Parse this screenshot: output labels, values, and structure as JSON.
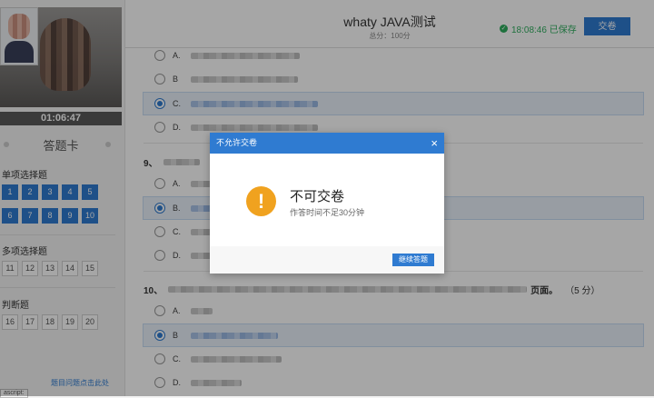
{
  "timer": "01:06:47",
  "answer_card": {
    "title": "答题卡",
    "sections": [
      {
        "label": "单项选择题",
        "numbers": [
          "1",
          "2",
          "3",
          "4",
          "5",
          "6",
          "7",
          "8",
          "9",
          "10"
        ],
        "state": "answered"
      },
      {
        "label": "多项选择题",
        "numbers": [
          "11",
          "12",
          "13",
          "14",
          "15"
        ],
        "state": "unanswered"
      },
      {
        "label": "判断题",
        "numbers": [
          "16",
          "17",
          "18",
          "19",
          "20"
        ],
        "state": "unanswered"
      }
    ],
    "help_link": "题目问题点击此处"
  },
  "status_label": "ascript:",
  "header": {
    "title": "whaty JAVA测试",
    "score": "总分：100分",
    "saved": "18:08:46 已保存",
    "submit": "交卷"
  },
  "questions": {
    "q8_options": [
      {
        "letter": "A."
      },
      {
        "letter": "B"
      },
      {
        "letter": "C."
      },
      {
        "letter": "D."
      }
    ],
    "q9_number": "9、",
    "q9_options": [
      {
        "letter": "A."
      },
      {
        "letter": "B."
      },
      {
        "letter": "C."
      },
      {
        "letter": "D."
      }
    ],
    "q10_number": "10、",
    "q10_tail": "页面。",
    "q10_points": "（5 分）",
    "q10_options": [
      {
        "letter": "A."
      },
      {
        "letter": "B"
      },
      {
        "letter": "C."
      },
      {
        "letter": "D."
      }
    ]
  },
  "modal": {
    "title": "不允许交卷",
    "close": "×",
    "heading": "不可交卷",
    "message": "作答时间不足30分钟",
    "continue": "继续答题"
  },
  "colors": {
    "primary": "#2f7bd1",
    "warning": "#f0a21f",
    "saved": "#2fae5f"
  }
}
